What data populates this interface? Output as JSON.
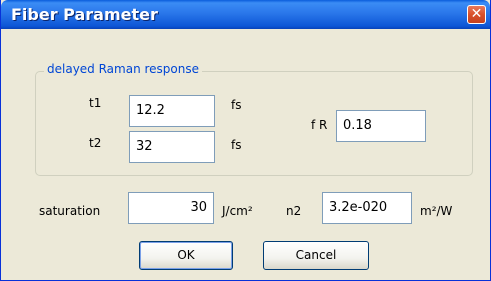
{
  "window": {
    "title": "Fiber Parameter",
    "close_glyph": "✕"
  },
  "group": {
    "legend": "delayed Raman response",
    "t1": {
      "label": "t1",
      "value": "12.2",
      "unit": "fs"
    },
    "t2": {
      "label": "t2",
      "value": "32",
      "unit": "fs"
    },
    "fR": {
      "label": "f R",
      "value": "0.18"
    }
  },
  "saturation": {
    "label": "saturation",
    "value": "30",
    "unit": "J/cm²"
  },
  "n2": {
    "label": "n2",
    "value": "3.2e-020",
    "unit": "m²/W"
  },
  "buttons": {
    "ok": "OK",
    "cancel": "Cancel"
  },
  "colors": {
    "titlebar_blue": "#0d56d6",
    "dialog_bg": "#ece9d8",
    "legend_text": "#0046d5",
    "close_red": "#d9502a"
  }
}
